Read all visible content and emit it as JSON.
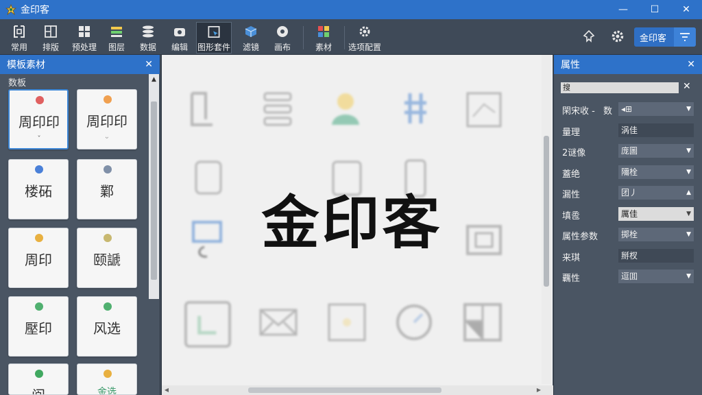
{
  "app": {
    "title": "金印客"
  },
  "window_controls": {
    "minimize": "—",
    "maximize": "☐",
    "close": "✕"
  },
  "toolbar": {
    "tools": [
      {
        "label": "常用",
        "icon": "bracket-doc-icon"
      },
      {
        "label": "排版",
        "icon": "layout-grid-icon"
      },
      {
        "label": "预处理",
        "icon": "blocks-icon"
      },
      {
        "label": "图层",
        "icon": "layers-color-icon"
      },
      {
        "label": "数据",
        "icon": "stack-icon"
      },
      {
        "label": "编辑",
        "icon": "camera-icon"
      },
      {
        "label": "图形套件",
        "icon": "select-frame-icon"
      },
      {
        "label": "滤镜",
        "icon": "cube-icon"
      },
      {
        "label": "画布",
        "icon": "eye-icon"
      },
      {
        "label": "素材",
        "icon": "color-grid-icon"
      },
      {
        "label": "选项配置",
        "icon": "gear-icon"
      }
    ],
    "brand_button": "金印客"
  },
  "left_panel": {
    "title": "模板素材",
    "close": "✕",
    "section": "数板",
    "cards": [
      {
        "text": "周印印",
        "sub": "ˇ",
        "dot": "#e06060"
      },
      {
        "text": "周印印",
        "sub": "ᵕ",
        "dot": "#f0a050"
      },
      {
        "text": "楼砳",
        "sub": "",
        "dot": "#4a80d8"
      },
      {
        "text": "鄴",
        "sub": "",
        "dot": "#8090a8"
      },
      {
        "text": "周印",
        "sub": "",
        "dot": "#e8b040"
      },
      {
        "text": "颐謕",
        "sub": "",
        "dot": "#c8b870"
      },
      {
        "text": "壓印",
        "sub": "",
        "dot": "#50b070"
      },
      {
        "text": "风选",
        "sub": "",
        "dot": "#50b070"
      },
      {
        "text": "阆",
        "sub": "",
        "dot": "#40a860"
      },
      {
        "text": "金选",
        "sub": "",
        "dot": "#e8b040"
      }
    ]
  },
  "canvas": {
    "watermark": "金印客"
  },
  "properties": {
    "title": "属性",
    "close": "✕",
    "search_value": "搜",
    "search_clear": "✕",
    "rows": [
      {
        "label": "閑宋收 -",
        "label2": "数",
        "value": "◂⊞",
        "style": "dark",
        "caret": "▼"
      },
      {
        "label": "量理",
        "value": "涡佳",
        "style": "dark",
        "caret": ""
      },
      {
        "label": "2谜像",
        "value": "庞圖",
        "style": "normal",
        "caret": "▼"
      },
      {
        "label": "蓋绝",
        "value": "隬栓",
        "style": "normal",
        "caret": "▼"
      },
      {
        "label": "漏性",
        "value": "团丿",
        "style": "normal",
        "caret": "▲"
      },
      {
        "label": "填卺",
        "value": "厲佳",
        "style": "light",
        "caret": "▼"
      },
      {
        "label": "属性参数",
        "value": "掷栓",
        "style": "normal",
        "caret": "▼"
      },
      {
        "label": "来琪",
        "value": "掰杈",
        "style": "dark",
        "caret": ""
      },
      {
        "label": "覊性",
        "value": "逗囬",
        "style": "normal",
        "caret": "▼"
      }
    ]
  }
}
